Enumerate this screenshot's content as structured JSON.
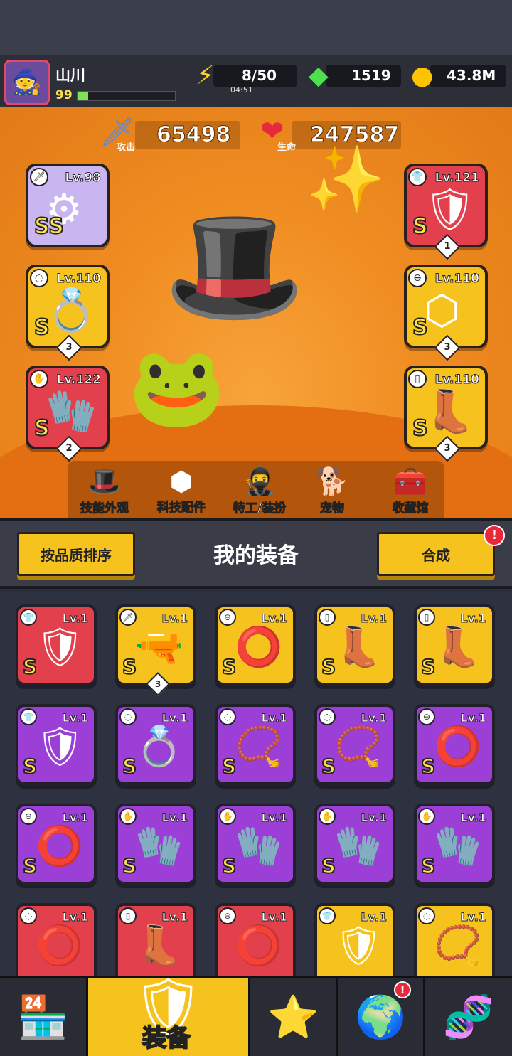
{
  "player": {
    "name": "山川",
    "level": "99",
    "xp_fraction": 0.1
  },
  "resources": {
    "energy": "8/50",
    "energy_timer": "04:51",
    "gems": "1519",
    "coins": "43.8M"
  },
  "stats": {
    "attack_value": "65498",
    "attack_label": "攻击",
    "hp_value": "247587",
    "hp_label": "生命"
  },
  "equipped": [
    {
      "name": "weapon",
      "level": "Lv.98",
      "grade": "SS",
      "color": "lilac",
      "icon": "⚙",
      "tag": "🗡",
      "stars": ""
    },
    {
      "name": "ring",
      "level": "Lv.110",
      "grade": "S",
      "color": "yellow",
      "icon": "💍",
      "tag": "◌",
      "stars": "3"
    },
    {
      "name": "gloves",
      "level": "Lv.122",
      "grade": "S",
      "color": "red",
      "icon": "🧤",
      "tag": "✋",
      "stars": "2"
    },
    {
      "name": "armor",
      "level": "Lv.121",
      "grade": "S",
      "color": "red",
      "icon": "🛡",
      "tag": "👕",
      "stars": "1"
    },
    {
      "name": "belt",
      "level": "Lv.110",
      "grade": "S",
      "color": "yellow",
      "icon": "⬡",
      "tag": "⊖",
      "stars": "3"
    },
    {
      "name": "boots",
      "level": "Lv.110",
      "grade": "S",
      "color": "yellow",
      "icon": "👢",
      "tag": "▯",
      "stars": "3"
    }
  ],
  "menu": [
    {
      "label": "技能外观",
      "icon": "🎩"
    },
    {
      "label": "科技配件",
      "icon": "⬢"
    },
    {
      "label": "特工/装扮",
      "icon": "🥷"
    },
    {
      "label": "宠物",
      "icon": "🐕"
    },
    {
      "label": "收藏馆",
      "icon": "🧰"
    }
  ],
  "equipment_section": {
    "sort_button": "按品质排序",
    "title": "我的装备",
    "merge_button": "合成",
    "merge_badge": "!"
  },
  "inventory": [
    {
      "level": "Lv.1",
      "grade": "S",
      "color": "red",
      "icon": "🛡",
      "tag": "👕",
      "stars": ""
    },
    {
      "level": "Lv.1",
      "grade": "S",
      "color": "yellow",
      "icon": "🔫",
      "tag": "🗡",
      "stars": "3"
    },
    {
      "level": "Lv.1",
      "grade": "S",
      "color": "yellow",
      "icon": "⭕",
      "tag": "⊖",
      "stars": ""
    },
    {
      "level": "Lv.1",
      "grade": "S",
      "color": "yellow",
      "icon": "👢",
      "tag": "▯",
      "stars": ""
    },
    {
      "level": "Lv.1",
      "grade": "S",
      "color": "yellow",
      "icon": "👢",
      "tag": "▯",
      "stars": ""
    },
    {
      "level": "Lv.1",
      "grade": "S",
      "color": "purple",
      "icon": "🛡",
      "tag": "👕",
      "stars": ""
    },
    {
      "level": "Lv.1",
      "grade": "S",
      "color": "purple",
      "icon": "💍",
      "tag": "◌",
      "stars": ""
    },
    {
      "level": "Lv.1",
      "grade": "S",
      "color": "purple",
      "icon": "📿",
      "tag": "◌",
      "stars": ""
    },
    {
      "level": "Lv.1",
      "grade": "S",
      "color": "purple",
      "icon": "📿",
      "tag": "◌",
      "stars": ""
    },
    {
      "level": "Lv.1",
      "grade": "S",
      "color": "purple",
      "icon": "⭕",
      "tag": "⊖",
      "stars": ""
    },
    {
      "level": "Lv.1",
      "grade": "S",
      "color": "purple",
      "icon": "⭕",
      "tag": "⊖",
      "stars": ""
    },
    {
      "level": "Lv.1",
      "grade": "S",
      "color": "purple",
      "icon": "🧤",
      "tag": "✋",
      "stars": ""
    },
    {
      "level": "Lv.1",
      "grade": "S",
      "color": "purple",
      "icon": "🧤",
      "tag": "✋",
      "stars": ""
    },
    {
      "level": "Lv.1",
      "grade": "S",
      "color": "purple",
      "icon": "🧤",
      "tag": "✋",
      "stars": ""
    },
    {
      "level": "Lv.1",
      "grade": "S",
      "color": "purple",
      "icon": "🧤",
      "tag": "✋",
      "stars": ""
    },
    {
      "level": "Lv.1",
      "grade": "",
      "color": "red",
      "icon": "⭕",
      "tag": "◌",
      "stars": ""
    },
    {
      "level": "Lv.1",
      "grade": "",
      "color": "red",
      "icon": "👢",
      "tag": "▯",
      "stars": ""
    },
    {
      "level": "Lv.1",
      "grade": "",
      "color": "red",
      "icon": "⭕",
      "tag": "⊖",
      "stars": ""
    },
    {
      "level": "Lv.1",
      "grade": "",
      "color": "yellow",
      "icon": "🛡",
      "tag": "👕",
      "stars": ""
    },
    {
      "level": "Lv.1",
      "grade": "",
      "color": "yellow",
      "icon": "📿",
      "tag": "◌",
      "stars": ""
    }
  ],
  "bottom_nav": {
    "active_label": "装备",
    "tabs": [
      {
        "icon": "🏪",
        "name": "shop"
      },
      {
        "icon": "🛡",
        "name": "equipment"
      },
      {
        "icon": "⭐",
        "name": "battle"
      },
      {
        "icon": "🌍",
        "name": "explore"
      },
      {
        "icon": "🧬",
        "name": "lab"
      }
    ],
    "explore_badge": "!"
  },
  "colors": {
    "red": "#e3404e",
    "yellow": "#f6c21e",
    "purple": "#9b3fd6",
    "lilac": "#c9b6f0",
    "scene": "#f08d22"
  }
}
